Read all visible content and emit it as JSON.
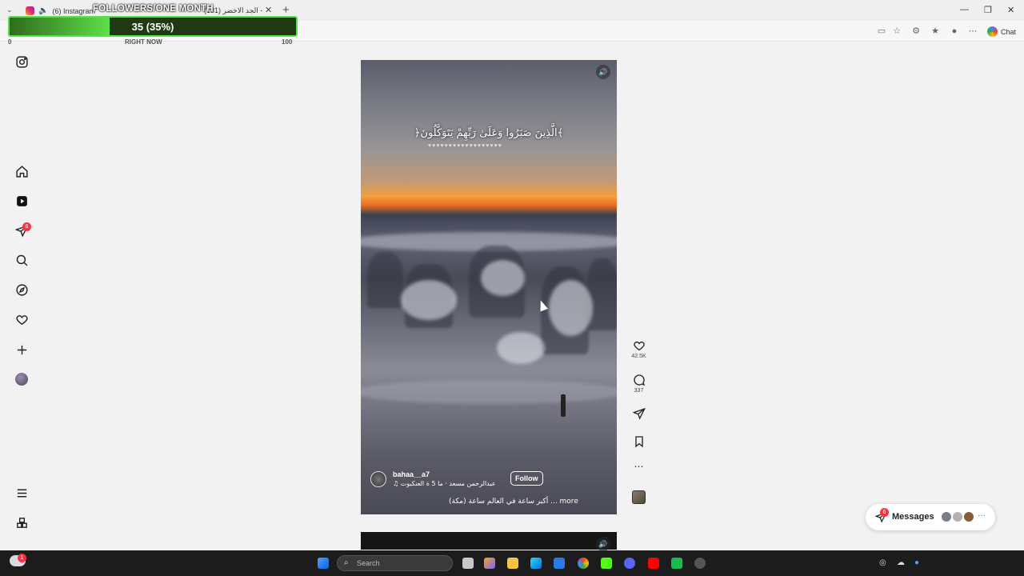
{
  "browser": {
    "tab1_label": "(6) Instagram",
    "tab2_label": "(131) الجد الاخضر -",
    "new_tab_label": "+",
    "chat_label": "Chat"
  },
  "overlay": {
    "title": "FOLLOWERS/ONE MONTH",
    "progress_text": "35 (35%)",
    "progress_value": 35,
    "progress_max": 100,
    "min_label": "0",
    "mid_label": "RIGHT NOW",
    "max_label": "100"
  },
  "nav": {
    "notifications_badge": "6"
  },
  "reel": {
    "caption": "﴿الَّذِينَ صَبَرُوا وَعَلَىٰ رَبِّهِمْ يَتَوَكَّلُونَ﴾",
    "dots": "♥♥♥♥♥♥♥♥♥♥♥♥♥♥♥♥♥♥",
    "username": "bahaa__a7",
    "music": "♫ عبدالرحمن مسعد · ما 5 ة العنكبوت",
    "follow_label": "Follow",
    "description": "أكبر ساعة في العالم ساعة (مكة) ... more"
  },
  "actions": {
    "likes": "42.5K",
    "comments": "337"
  },
  "messages": {
    "label": "Messages",
    "badge": "6",
    "more": "···"
  },
  "taskbar": {
    "search_placeholder": "Search",
    "notification_badge": "1"
  },
  "colors": {
    "progress_border": "#57e04a",
    "progress_fill": "#5ee048",
    "badge_red": "#ff3040"
  }
}
